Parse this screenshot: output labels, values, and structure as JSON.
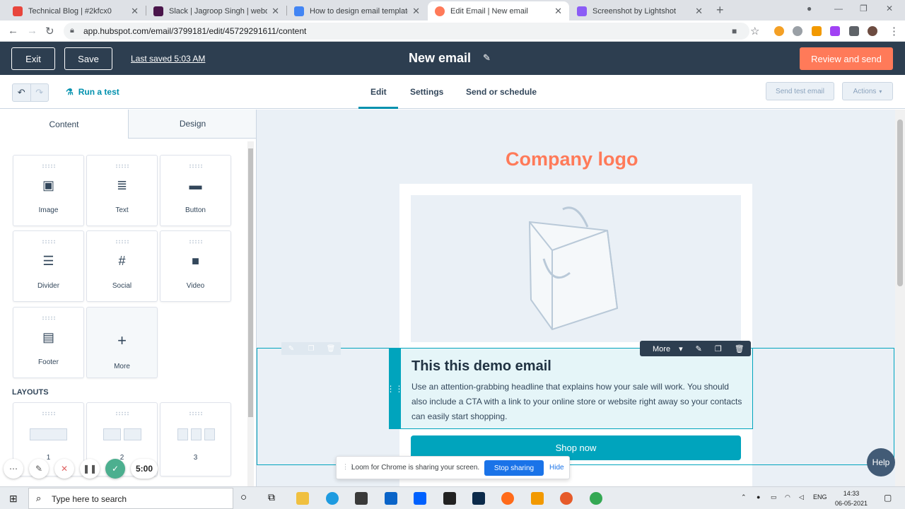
{
  "browser": {
    "tabs": [
      {
        "title": "Technical Blog | #2kfcx0",
        "color": "#e8453c"
      },
      {
        "title": "Slack | Jagroop Singh | webdew",
        "color": "#4a154b"
      },
      {
        "title": "How to design email template in",
        "color": "#4285f4"
      },
      {
        "title": "Edit Email | New email",
        "color": "#ff7a59"
      },
      {
        "title": "Screenshot by Lightshot",
        "color": "#8b5cf6"
      }
    ],
    "url": "app.hubspot.com/email/3799181/edit/45729291611/content"
  },
  "header": {
    "exit_label": "Exit",
    "save_label": "Save",
    "last_saved": "Last saved 5:03 AM",
    "title": "New email",
    "review_label": "Review and send"
  },
  "toolbar": {
    "run_test": "Run a test",
    "tabs": [
      "Edit",
      "Settings",
      "Send or schedule"
    ],
    "send_test": "Send test email",
    "actions": "Actions"
  },
  "panel": {
    "tabs": [
      "Content",
      "Design"
    ],
    "modules": [
      {
        "label": "Image",
        "icon": "image-icon"
      },
      {
        "label": "Text",
        "icon": "text-icon"
      },
      {
        "label": "Button",
        "icon": "button-icon"
      },
      {
        "label": "Divider",
        "icon": "divider-icon"
      },
      {
        "label": "Social",
        "icon": "social-icon"
      },
      {
        "label": "Video",
        "icon": "video-icon"
      },
      {
        "label": "Footer",
        "icon": "footer-icon"
      },
      {
        "label": "More",
        "icon": "plus-icon"
      }
    ],
    "layouts_heading": "LAYOUTS",
    "layouts": [
      "1",
      "2",
      "3"
    ]
  },
  "canvas": {
    "logo_text": "Company logo",
    "heading": "This this demo email",
    "body": "Use an attention-grabbing headline that explains how your sale will work. You should also include a CTA with a link to your online store or website right away so your contacts can easily start shopping.",
    "module_more": "More",
    "shop_button": "Shop now"
  },
  "loom": {
    "timer": "5:00",
    "share_message": "Loom for Chrome is sharing your screen.",
    "stop_label": "Stop sharing",
    "hide_label": "Hide"
  },
  "help_label": "Help",
  "taskbar": {
    "search_placeholder": "Type here to search",
    "lang": "ENG",
    "time": "14:33",
    "date": "06-05-2021"
  }
}
